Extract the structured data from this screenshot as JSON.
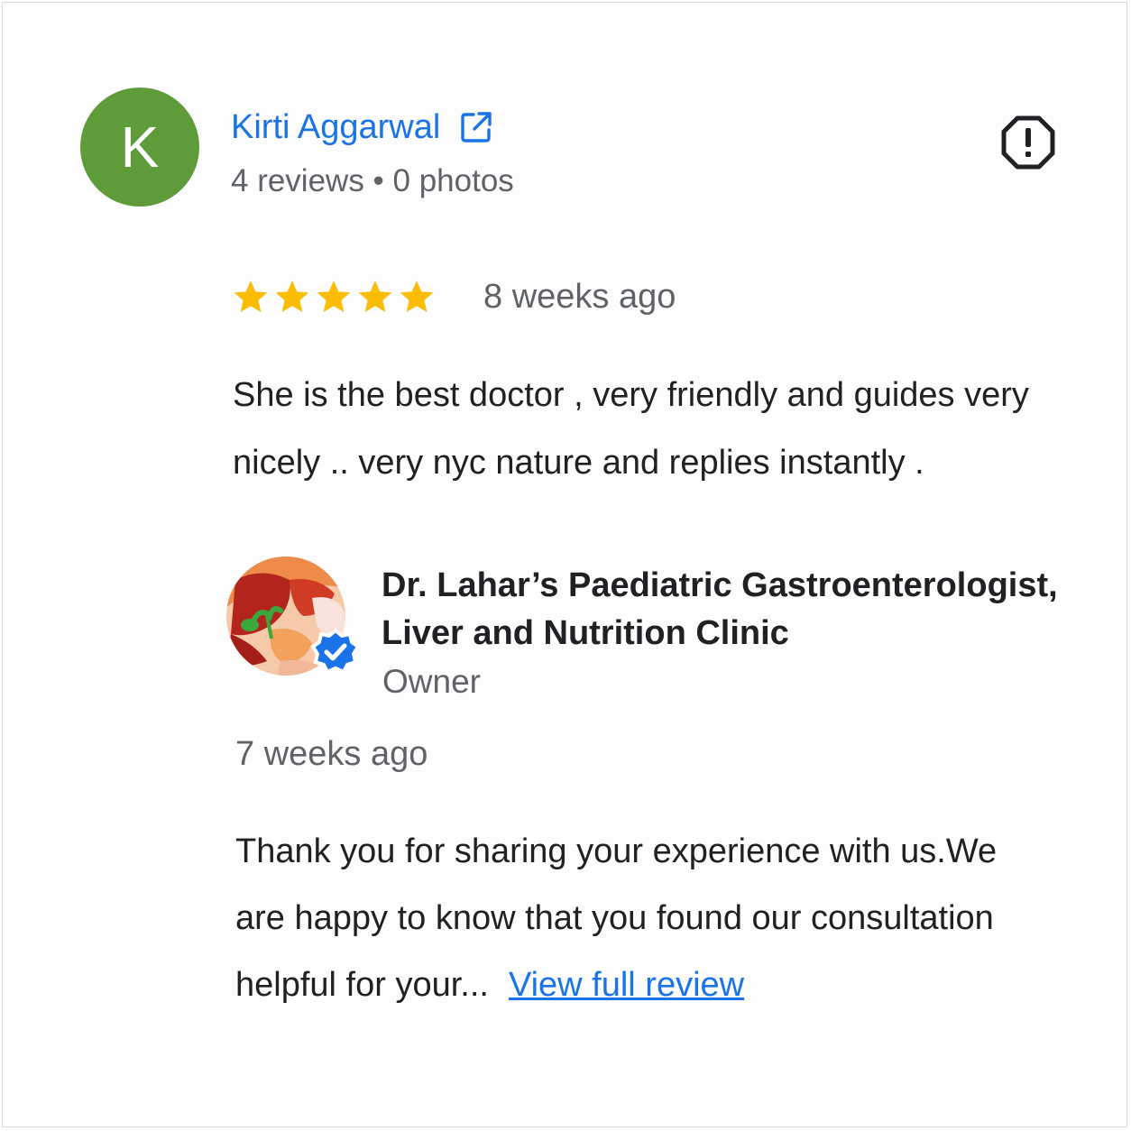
{
  "reviewer": {
    "avatar_letter": "K",
    "avatar_color": "#5e9c3a",
    "name": "Kirti Aggarwal",
    "external_link_icon": "external-link-icon",
    "meta": "4 reviews • 0 photos",
    "report_icon": "report-icon"
  },
  "review": {
    "rating": 5,
    "max_rating": 5,
    "star_color": "#fbbc04",
    "date": "8 weeks ago",
    "text": "She is the best doctor , very friendly and guides very nicely .. very nyc nature and replies instantly ."
  },
  "owner_reply": {
    "name": "Dr. Lahar’s Paediatric Gastroenterologist, Liver and Nutrition Clinic",
    "role": "Owner",
    "verified_icon": "verified-badge-icon",
    "date": "7 weeks ago",
    "text": "Thank you for sharing your experience with us.We are happy to know that you found our consultation helpful for your...",
    "view_full_label": "View full review"
  },
  "colors": {
    "link": "#1a73e8",
    "secondary_text": "#5f6368",
    "primary_text": "#202124"
  }
}
